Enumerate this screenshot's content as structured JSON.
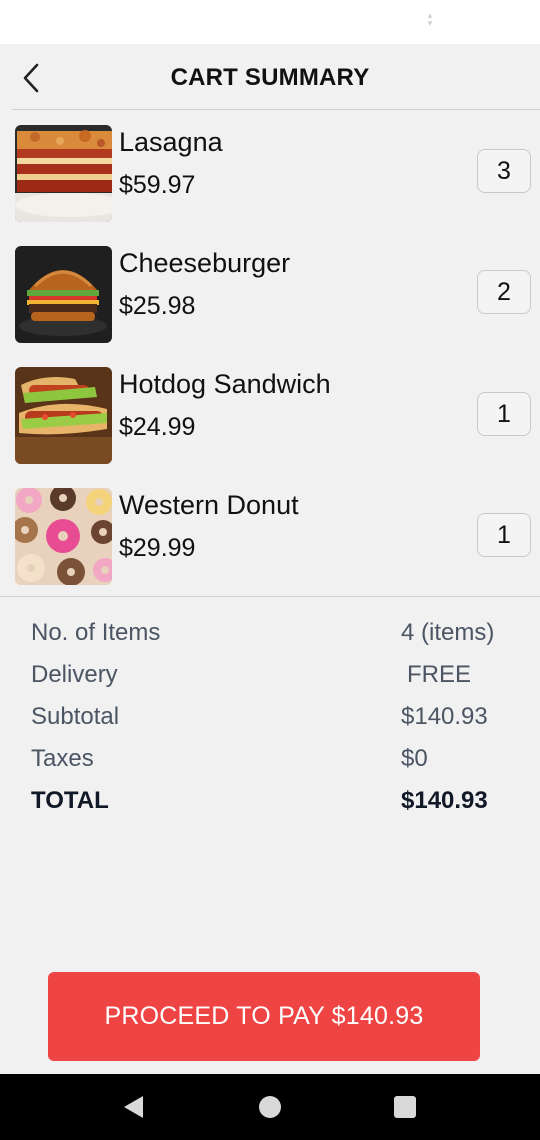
{
  "header": {
    "title": "CART SUMMARY",
    "back_icon": "chevron-left-icon"
  },
  "items": [
    {
      "name": "Lasagna",
      "price": "$59.97",
      "quantity": "3",
      "image": "lasagna-image"
    },
    {
      "name": "Cheeseburger",
      "price": "$25.98",
      "quantity": "2",
      "image": "cheeseburger-image"
    },
    {
      "name": "Hotdog Sandwich",
      "price": "$24.99",
      "quantity": "1",
      "image": "hotdog-image"
    },
    {
      "name": "Western Donut",
      "price": "$29.99",
      "quantity": "1",
      "image": "donut-image"
    }
  ],
  "summary": {
    "items_label": "No. of Items",
    "items_value": "4 (items)",
    "delivery_label": "Delivery",
    "delivery_value": "FREE",
    "subtotal_label": "Subtotal",
    "subtotal_value": "$140.93",
    "taxes_label": "Taxes",
    "taxes_value": "$0",
    "total_label": "TOTAL",
    "total_value": "$140.93"
  },
  "pay_button": {
    "label": "PROCEED TO PAY $140.93"
  },
  "nav": {
    "back": "triangle-back-icon",
    "home": "circle-home-icon",
    "recents": "square-recents-icon"
  },
  "colors": {
    "accent": "#ef4444",
    "background": "#f1f1f1",
    "muted_text": "#4b5563"
  }
}
